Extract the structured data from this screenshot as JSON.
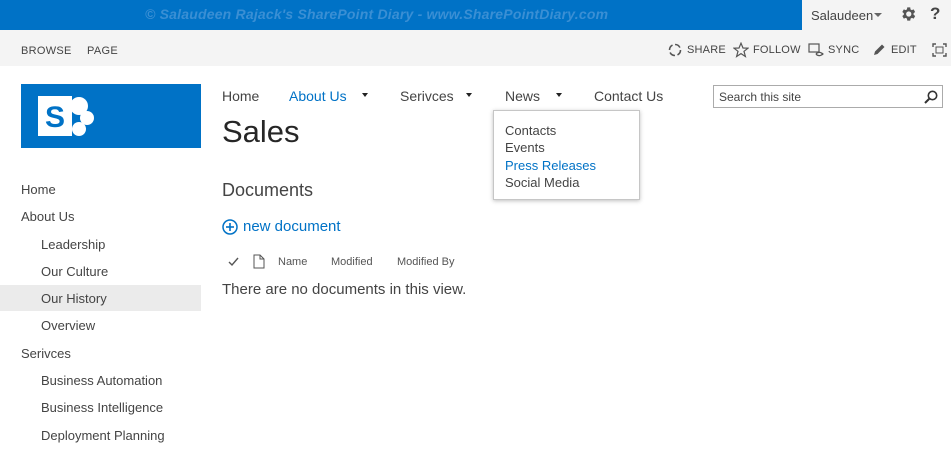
{
  "suite_bar": {
    "watermark": "© Salaudeen Rajack's SharePoint Diary - www.SharePointDiary.com",
    "user_name": "Salaudeen",
    "help_glyph": "?",
    "brand_color": "#0072c6"
  },
  "ribbon": {
    "tabs": [
      "BROWSE",
      "PAGE"
    ],
    "actions": [
      {
        "label": "SHARE",
        "icon": "share-icon"
      },
      {
        "label": "FOLLOW",
        "icon": "star-icon"
      },
      {
        "label": "SYNC",
        "icon": "sync-icon"
      },
      {
        "label": "EDIT",
        "icon": "pencil-icon"
      }
    ]
  },
  "top_nav": {
    "items": [
      {
        "label": "Home",
        "has_menu": false
      },
      {
        "label": "About Us",
        "has_menu": true,
        "active": true
      },
      {
        "label": "Serivces",
        "has_menu": true
      },
      {
        "label": "News",
        "has_menu": true
      },
      {
        "label": "Contact Us",
        "has_menu": false
      }
    ],
    "news_dropdown": [
      "Contacts",
      "Events",
      "Press Releases",
      "Social Media"
    ]
  },
  "search": {
    "placeholder": "Search this site"
  },
  "page_title": "Sales",
  "quick_launch": [
    {
      "label": "Home",
      "level": 0
    },
    {
      "label": "About Us",
      "level": 0
    },
    {
      "label": "Leadership",
      "level": 1
    },
    {
      "label": "Our Culture",
      "level": 1
    },
    {
      "label": "Our History",
      "level": 1,
      "selected": true
    },
    {
      "label": "Overview",
      "level": 1
    },
    {
      "label": "Serivces",
      "level": 0
    },
    {
      "label": "Business Automation",
      "level": 1
    },
    {
      "label": "Business Intelligence",
      "level": 1
    },
    {
      "label": "Deployment Planning",
      "level": 1
    }
  ],
  "documents": {
    "title": "Documents",
    "new_label": "new document",
    "columns": [
      "Name",
      "Modified",
      "Modified By"
    ],
    "empty_message": "There are no documents in this view."
  }
}
